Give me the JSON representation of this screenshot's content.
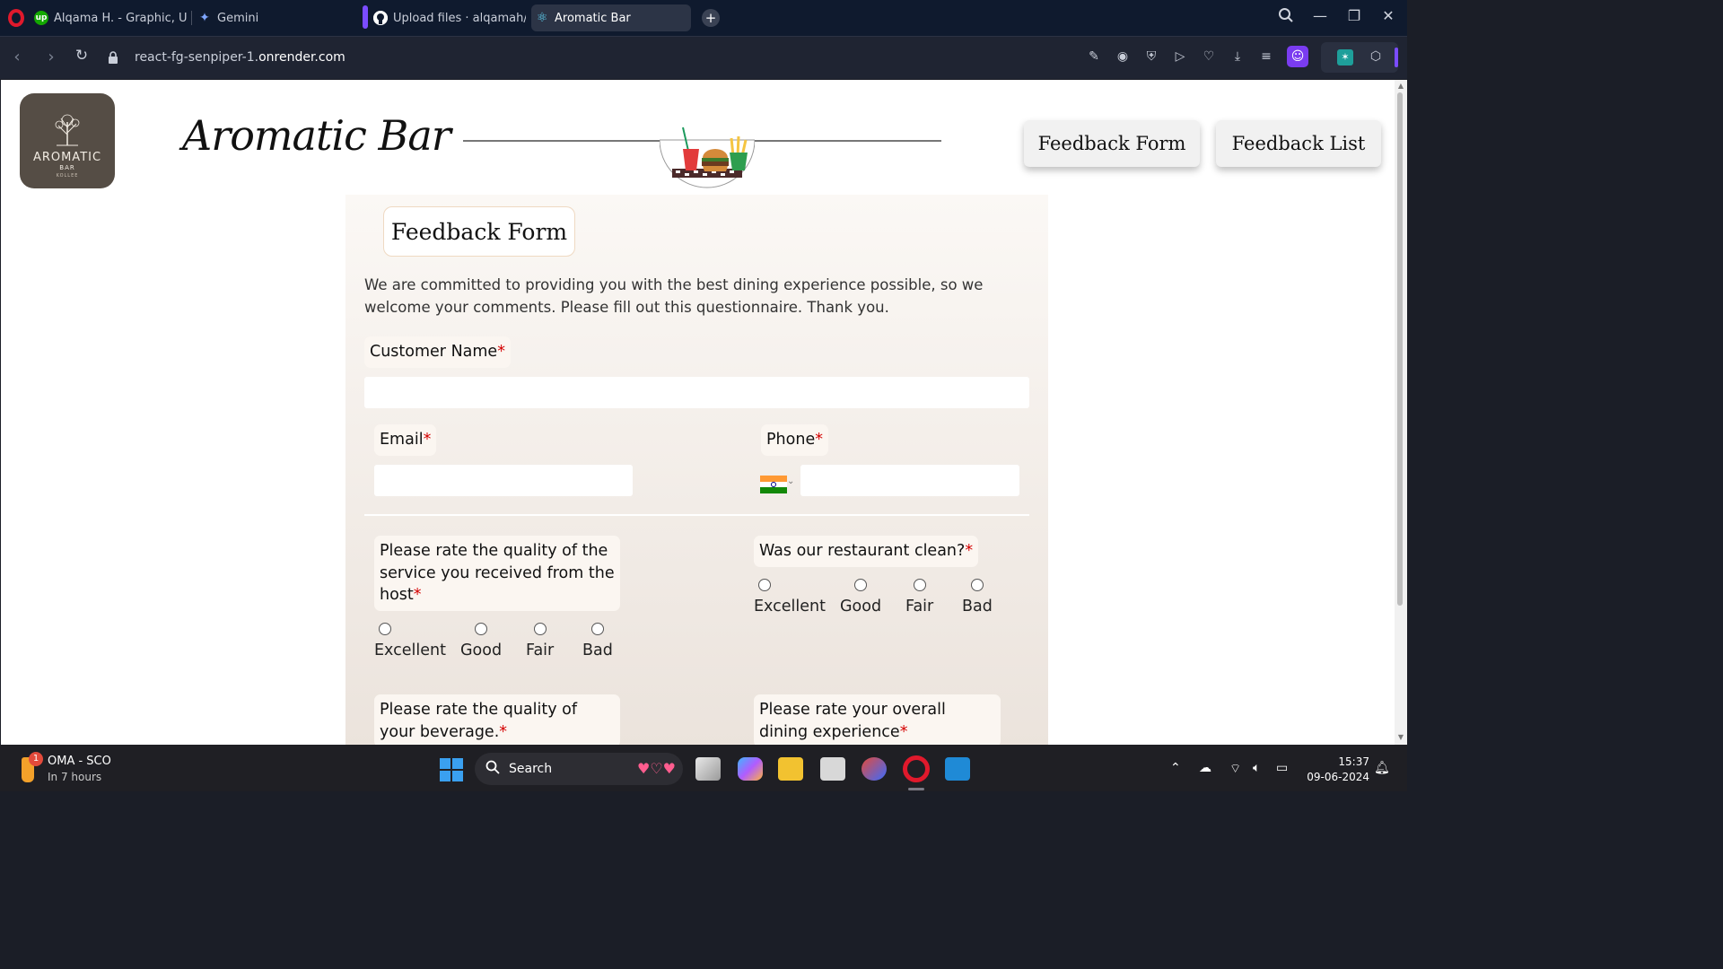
{
  "browser": {
    "tabs": [
      {
        "label": "Alqama H. - Graphic, UI/U",
        "icon": "upwork-icon"
      },
      {
        "label": "Gemini",
        "icon": "gemini-icon"
      },
      {
        "label": "Upload files · alqamah/rea",
        "icon": "github-icon"
      },
      {
        "label": "Aromatic Bar",
        "icon": "react-icon",
        "active": true
      }
    ],
    "url_prefix": "react-fg-senpiper-1.",
    "url_domain": "onrender.com"
  },
  "site": {
    "logo": {
      "name": "AROMATIC",
      "sub": "BAR",
      "sub2": "KOLLEE"
    },
    "brand": "Aromatic Bar",
    "nav": [
      "Feedback Form",
      "Feedback List"
    ]
  },
  "form": {
    "title": "Feedback Form",
    "intro": "We are committed to providing you with the best dining experience possible, so we welcome your comments. Please fill out this questionnaire. Thank you.",
    "required_mark": "*",
    "customer_name_label": "Customer Name",
    "email_label": "Email",
    "phone_label": "Phone",
    "phone_country": "India",
    "q_host": "Please rate the quality of the service you received from the host",
    "q_clean": "Was our restaurant clean?",
    "q_beverage": "Please rate the quality of your beverage.",
    "q_overall": "Please rate your overall dining experience",
    "options": [
      "Excellent",
      "Good",
      "Fair",
      "Bad"
    ]
  },
  "taskbar": {
    "weather_badge": "1",
    "weather_title": "OMA - SCO",
    "weather_sub": "In 7 hours",
    "search_label": "Search",
    "time": "15:37",
    "date": "09-06-2024"
  },
  "colors": {
    "accent_required": "#d40000",
    "logo_bg": "#554d45",
    "panel_top": "#fbf8f5",
    "panel_bottom": "#ebe3dc"
  }
}
